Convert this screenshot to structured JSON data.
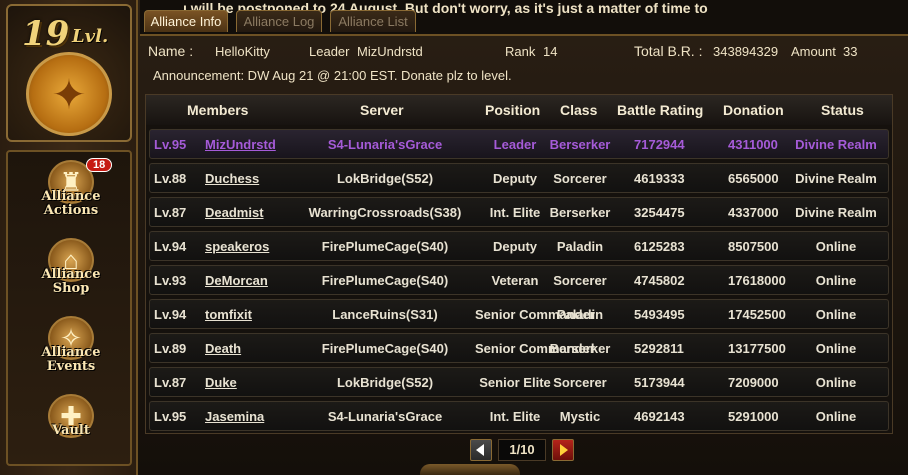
{
  "sidebar": {
    "level_number": "19",
    "level_suffix": "Lvl.",
    "nav": [
      {
        "label_1": "Alliance",
        "label_2": "Actions",
        "badge": "18",
        "icon": "fortress-icon"
      },
      {
        "label_1": "Alliance",
        "label_2": "Shop",
        "icon": "shop-icon"
      },
      {
        "label_1": "Alliance",
        "label_2": "Events",
        "icon": "events-icon"
      },
      {
        "label_1": "Vault",
        "icon": "vault-icon"
      }
    ]
  },
  "ticker": "ı will be postponed to 24 August. But don't worry, as it's just a matter of time to",
  "tabs": [
    "Alliance Info",
    "Alliance Log",
    "Alliance List"
  ],
  "info": {
    "name_label": "Name :",
    "name_value": "HelloKitty",
    "leader_label": "Leader",
    "leader_value": "MizUndrstd",
    "rank_label": "Rank",
    "rank_value": "14",
    "br_label": "Total B.R. :",
    "br_value": "343894329",
    "amount_label": "Amount",
    "amount_value": "33",
    "announcement": "Announcement:  DW Aug 21 @ 21:00 EST. Donate plz to level."
  },
  "table": {
    "headers": [
      "Members",
      "Server",
      "Position",
      "Class",
      "Battle Rating",
      "Donation",
      "Status"
    ],
    "rows": [
      [
        "Lv.95",
        "MizUndrstd",
        "S4-Lunaria'sGrace",
        "Leader",
        "Berserker",
        "7172944",
        "4311000",
        "Divine Realm"
      ],
      [
        "Lv.88",
        "Duchess",
        "LokBridge(S52)",
        "Deputy",
        "Sorcerer",
        "4619333",
        "6565000",
        "Divine Realm"
      ],
      [
        "Lv.87",
        "Deadmist",
        "WarringCrossroads(S38)",
        "Int. Elite",
        "Berserker",
        "3254475",
        "4337000",
        "Divine Realm"
      ],
      [
        "Lv.94",
        "speakeros",
        "FirePlumeCage(S40)",
        "Deputy",
        "Paladin",
        "6125283",
        "8507500",
        "Online"
      ],
      [
        "Lv.93",
        "DeMorcan",
        "FirePlumeCage(S40)",
        "Veteran",
        "Sorcerer",
        "4745802",
        "17618000",
        "Online"
      ],
      [
        "Lv.94",
        "tomfixit",
        "LanceRuins(S31)",
        "Senior Commander",
        "Paladin",
        "5493495",
        "17452500",
        "Online"
      ],
      [
        "Lv.89",
        "Death",
        "FirePlumeCage(S40)",
        "Senior Commander",
        "Berserker",
        "5292811",
        "13177500",
        "Online"
      ],
      [
        "Lv.87",
        "Duke",
        "LokBridge(S52)",
        "Senior Elite",
        "Sorcerer",
        "5173944",
        "7209000",
        "Online"
      ],
      [
        "Lv.95",
        "Jasemina",
        "S4-Lunaria'sGrace",
        "Int. Elite",
        "Mystic",
        "4692143",
        "5291000",
        "Online"
      ]
    ]
  },
  "pager": {
    "current": "1/10"
  },
  "colors": {
    "self_row": "#a55bd8",
    "accent_gold": "#8a6a34"
  }
}
